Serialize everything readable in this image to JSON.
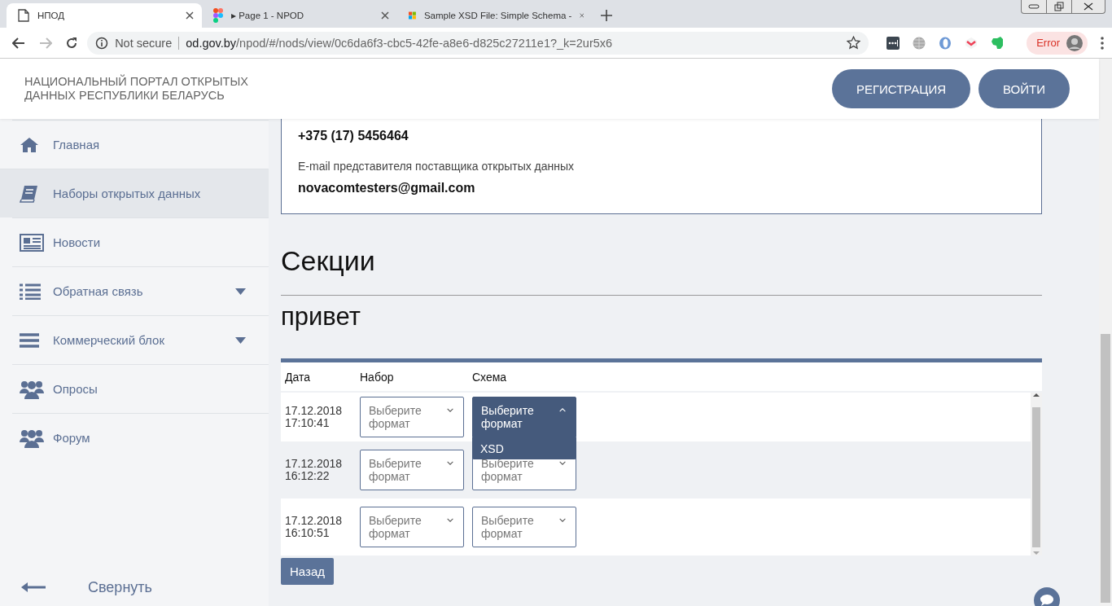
{
  "browser": {
    "tabs": [
      {
        "title": "НПОД",
        "kind": "page",
        "selected": true
      },
      {
        "title": "▸ Page 1 - NPOD",
        "kind": "figma",
        "selected": false
      },
      {
        "title": "Sample XSD File: Simple Schema -",
        "kind": "windows",
        "selected": false
      }
    ],
    "address": {
      "security": "Not secure",
      "host": "od.gov.by",
      "path": "/npod/#/nods/view/0c6da6f3-cbc5-42fe-a8e6-d825c27211e1?_k=2ur5x6"
    },
    "profile_status": "Error"
  },
  "header": {
    "portal_title": "НАЦИОНАЛЬНЫЙ ПОРТАЛ ОТКРЫТЫХ ДАННЫХ РЕСПУБЛИКИ БЕЛАРУСЬ",
    "buttons": [
      "РЕГИСТРАЦИЯ",
      "ВОЙТИ"
    ]
  },
  "sidebar": {
    "items": [
      {
        "label": "Главная",
        "kind": "home",
        "selected": false,
        "expandable": false
      },
      {
        "label": "Наборы открытых данных",
        "kind": "book",
        "selected": true,
        "expandable": false
      },
      {
        "label": "Новости",
        "kind": "news",
        "selected": false,
        "expandable": false
      },
      {
        "label": "Обратная связь",
        "kind": "list",
        "selected": false,
        "expandable": true
      },
      {
        "label": "Коммерческий блок",
        "kind": "bars",
        "selected": false,
        "expandable": true
      },
      {
        "label": "Опросы",
        "kind": "users",
        "selected": false,
        "expandable": false
      },
      {
        "label": "Форум",
        "kind": "users",
        "selected": false,
        "expandable": false
      }
    ],
    "collapse": "Свернуть"
  },
  "contact": {
    "phone": "+375 (17) 5456464",
    "email_label": "E-mail представителя поставщика открытых данных",
    "email": "novacomtesters@gmail.com"
  },
  "sections_title": "Секции",
  "section_name": "привет",
  "table": {
    "columns": [
      "Дата",
      "Набор",
      "Схема"
    ],
    "rows": [
      {
        "date": "17.12.2018",
        "time": "17:10:41",
        "set": {
          "placeholder": "Выберите формат"
        },
        "schema": {
          "placeholder": "Выберите формат",
          "expanded": true,
          "options": [
            "XSD"
          ]
        }
      },
      {
        "date": "17.12.2018",
        "time": "16:12:22",
        "set": {
          "placeholder": "Выберите формат"
        },
        "schema": {
          "placeholder": "Выберите формат",
          "expanded": false
        }
      },
      {
        "date": "17.12.2018",
        "time": "16:10:51",
        "set": {
          "placeholder": "Выберите формат"
        },
        "schema": {
          "placeholder": "Выберите формат",
          "expanded": false
        }
      }
    ]
  },
  "back_button": "Назад"
}
